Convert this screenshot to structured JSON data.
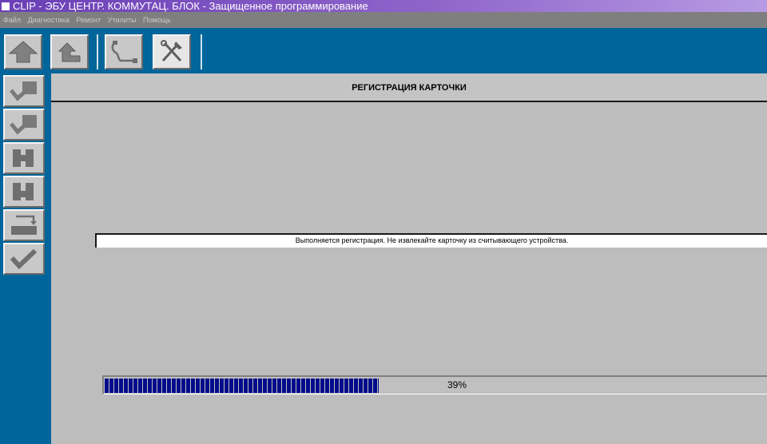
{
  "window": {
    "title": "CLIP - ЭБУ ЦЕНТР. КОММУТАЦ. БЛОК - Защищенное программирование"
  },
  "menu": [
    "Файл",
    "Диагностика",
    "Ремонт",
    "Утилиты",
    "Помощь"
  ],
  "toolbar": {
    "buttons": [
      {
        "icon": "home-arrow-icon"
      },
      {
        "icon": "back-arrow-icon"
      },
      {
        "icon": "diagnostic-cable-icon"
      },
      {
        "icon": "tools-icon",
        "active": true
      }
    ]
  },
  "sidebar": {
    "buttons": [
      {
        "icon": "car-check-icon"
      },
      {
        "icon": "car-check-icon"
      },
      {
        "icon": "module-icon"
      },
      {
        "icon": "module-config-icon"
      },
      {
        "icon": "transfer-icon"
      },
      {
        "icon": "check-icon"
      }
    ]
  },
  "panel": {
    "title": "РЕГИСТРАЦИЯ КАРТОЧКИ",
    "message": "Выполняется регистрация. Не извлекайте карточку из считывающего устройства.",
    "progress": {
      "value": 39,
      "label": "39%"
    }
  },
  "colors": {
    "accent": "#00659a",
    "progress_fill": "#000c8a",
    "panel_bg": "#bdbdbd"
  }
}
